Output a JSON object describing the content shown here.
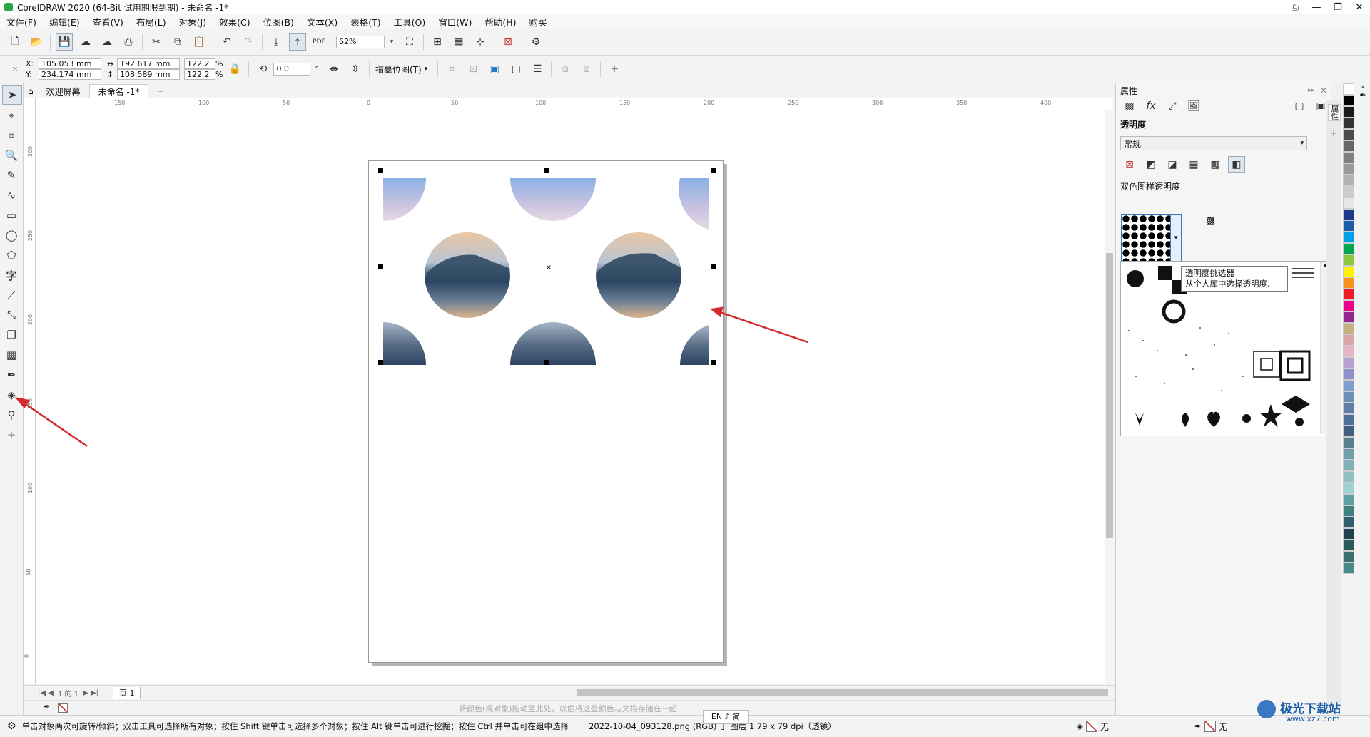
{
  "window": {
    "title": "CorelDRAW 2020 (64-Bit 试用期限到期) - 未命名 -1*"
  },
  "menu": [
    "文件(F)",
    "编辑(E)",
    "查看(V)",
    "布局(L)",
    "对象(J)",
    "效果(C)",
    "位图(B)",
    "文本(X)",
    "表格(T)",
    "工具(O)",
    "窗口(W)",
    "帮助(H)",
    "购买"
  ],
  "toolbar": {
    "zoom": "62%"
  },
  "propbar": {
    "x_label": "X:",
    "x_value": "105.053 mm",
    "y_label": "Y:",
    "y_value": "234.174 mm",
    "w_value": "192.617 mm",
    "h_value": "108.589 mm",
    "scale_w": "122.2",
    "scale_h": "122.2",
    "pct": "%",
    "angle": "0.0",
    "trace_label": "描摹位图(T)"
  },
  "tabs": {
    "welcome": "欢迎屏幕",
    "doc": "未命名 -1*"
  },
  "ruler": {
    "h_labels": [
      "150",
      "100",
      "50",
      "0",
      "50",
      "100",
      "150",
      "200",
      "250",
      "300",
      "350",
      "400"
    ],
    "v_labels": [
      "300",
      "250",
      "200",
      "150",
      "100",
      "50",
      "0"
    ]
  },
  "pages": {
    "info": "1 的 1",
    "page_tab": "页 1"
  },
  "colorbar_hint": "将颜色(或对象)拖动至此处，以便将这些颜色与文档存储在一起",
  "docker": {
    "title": "属性",
    "section": "透明度",
    "mode": "常规",
    "pattern_label": "双色图样透明度"
  },
  "tooltip": {
    "title": "透明度挑选器",
    "desc": "从个人库中选择透明度."
  },
  "status": {
    "hint": "单击对象两次可旋转/倾斜；双击工具可选择所有对象；按住 Shift 键单击可选择多个对象；按住 Alt 键单击可进行挖掘；按住 Ctrl 并单击可在组中选择",
    "object_info": "2022-10-04_093128.png (RGB) 于 图层 1 79 x 79 dpi（透镜）",
    "fill_label": "无",
    "outline_label": "无",
    "ime": "EN ♪ 简"
  },
  "watermark": {
    "text": "极光下载站",
    "url": "www.xz7.com"
  },
  "colors": {
    "accent": "#3a78c2",
    "arrow": "#d42a2a"
  }
}
